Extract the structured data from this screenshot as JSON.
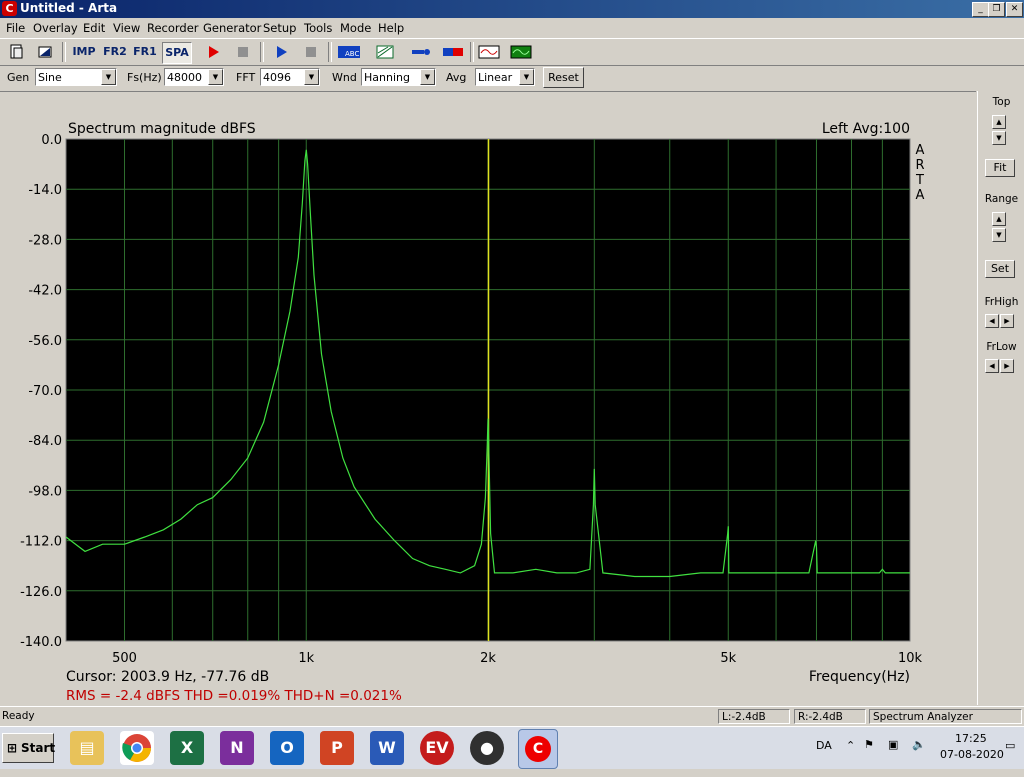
{
  "window": {
    "title": "Untitled - Arta",
    "app_icon": "C"
  },
  "menu": [
    "File",
    "Overlay",
    "Edit",
    "View",
    "Recorder",
    "Generator",
    "Setup",
    "Tools",
    "Mode",
    "Help"
  ],
  "toolbar": {
    "imp": "IMP",
    "fr2": "FR2",
    "fr1": "FR1",
    "spa": "SPA"
  },
  "controls": {
    "gen_label": "Gen",
    "gen_value": "Sine",
    "fs_label": "Fs(Hz)",
    "fs_value": "48000",
    "fft_label": "FFT",
    "fft_value": "4096",
    "wnd_label": "Wnd",
    "wnd_value": "Hanning",
    "avg_label": "Avg",
    "avg_value": "Linear",
    "reset_label": "Reset"
  },
  "right_panel": {
    "top_label": "Top",
    "fit_label": "Fit",
    "range_label": "Range",
    "set_label": "Set",
    "frhigh_label": "FrHigh",
    "frlow_label": "FrLow"
  },
  "chart_data": {
    "type": "line",
    "title": "Spectrum magnitude dBFS",
    "channel_info": "Left  Avg:100",
    "brand_vertical": "ARTA",
    "xlabel": "Frequency(Hz)",
    "x_scale": "log",
    "xlim": [
      400,
      10000
    ],
    "ylim": [
      -140,
      0
    ],
    "y_ticks": [
      "0.0",
      "-14.0",
      "-28.0",
      "-42.0",
      "-56.0",
      "-70.0",
      "-84.0",
      "-98.0",
      "-112.0",
      "-126.0",
      "-140.0"
    ],
    "x_tick_labels": [
      {
        "f": 500,
        "label": "500"
      },
      {
        "f": 1000,
        "label": "1k"
      },
      {
        "f": 2000,
        "label": "2k"
      },
      {
        "f": 5000,
        "label": "5k"
      },
      {
        "f": 10000,
        "label": "10k"
      }
    ],
    "grid_minor_x": [
      600,
      700,
      800,
      900,
      3000,
      4000,
      6000,
      7000,
      8000,
      9000
    ],
    "cursor_freq": 2003.9,
    "series": [
      {
        "color": "#40e040",
        "x": [
          400,
          430,
          460,
          500,
          540,
          580,
          620,
          660,
          700,
          750,
          800,
          850,
          900,
          940,
          970,
          985,
          995,
          1000,
          1005,
          1015,
          1030,
          1060,
          1100,
          1150,
          1200,
          1300,
          1400,
          1500,
          1600,
          1700,
          1800,
          1900,
          1950,
          1980,
          1995,
          2000,
          2005,
          2020,
          2050,
          2100,
          2200,
          2400,
          2600,
          2800,
          2950,
          2990,
          3000,
          3010,
          3100,
          3500,
          4000,
          4500,
          4900,
          4990,
          5000,
          5010,
          5200,
          6000,
          6800,
          6980,
          7000,
          7020,
          7500,
          8000,
          8900,
          9000,
          9100,
          10000
        ],
        "y": [
          -111,
          -115,
          -113,
          -113,
          -111,
          -109,
          -106,
          -102,
          -100,
          -95,
          -89,
          -79,
          -63,
          -48,
          -33,
          -18,
          -6,
          -3,
          -7,
          -20,
          -38,
          -60,
          -76,
          -89,
          -97,
          -106,
          -112,
          -117,
          -119,
          -120,
          -121,
          -119,
          -113,
          -100,
          -85,
          -78,
          -85,
          -110,
          -121,
          -121,
          -121,
          -120,
          -121,
          -121,
          -120,
          -102,
          -92,
          -102,
          -121,
          -122,
          -122,
          -121,
          -121,
          -110,
          -108,
          -121,
          -121,
          -121,
          -121,
          -112,
          -114,
          -121,
          -121,
          -121,
          -121,
          -120,
          -121,
          -121
        ]
      }
    ]
  },
  "readouts": {
    "cursor": "Cursor:  2003.9 Hz, -77.76 dB",
    "rms": "RMS =   -2.4 dBFS   THD =0.019%   THD+N =0.021%"
  },
  "status": {
    "ready": "Ready",
    "left": "L:-2.4dB",
    "right": "R:-2.4dB",
    "mode": "Spectrum Analyzer"
  },
  "taskbar": {
    "start": "Start",
    "lang": "DA",
    "time": "17:25",
    "date": "07-08-2020"
  },
  "colors": {
    "plot_bg": "#000000",
    "grid": "#2e6e2e",
    "trace": "#40e040",
    "cursor": "#e0e020",
    "readout_red": "#c00000"
  }
}
